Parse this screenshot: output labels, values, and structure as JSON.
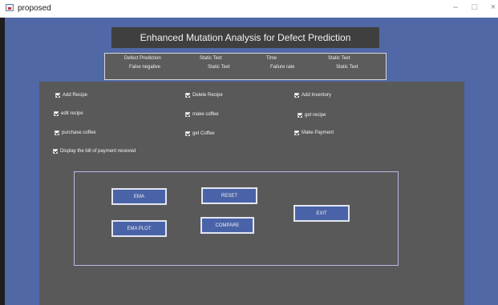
{
  "window": {
    "title": "proposed",
    "controls": {
      "minimize": "–",
      "maximize": "□",
      "close": "×"
    }
  },
  "header": {
    "title": "Enhanced Mutation Analysis for Defect Prediction"
  },
  "stats": {
    "defect_prediction_label": "Defect Prediction",
    "defect_prediction_value": "Static Text",
    "time_label": "Time",
    "time_value": "Static Text",
    "false_negative_label": "False negative",
    "false_negative_value": "Static Text",
    "failure_rate_label": "Failure rate",
    "failure_rate_value": "Static Text"
  },
  "checkboxes": {
    "add_recipe": "Add Recipe",
    "delete_recipe": "Delete Recipe",
    "add_inventory": "Add Inventory",
    "edit_recipe": "edit recipe",
    "make_coffee": "make coffee",
    "get_recipe": "get recipe",
    "purchase_coffee": "purchase coffee",
    "get_coffee": "get Coffee",
    "make_payment": "Make Payment",
    "display_bill": "Display the bill of payment received"
  },
  "buttons": {
    "ema": "EMA",
    "reset": "RESET",
    "ema_plot": "EMA PLOT",
    "compare": "COMPARE",
    "exit": "EXIT"
  },
  "colors": {
    "canvas": "#5068a6",
    "panel": "#595959",
    "header": "#3f3f3f",
    "button": "#4a63a8"
  }
}
